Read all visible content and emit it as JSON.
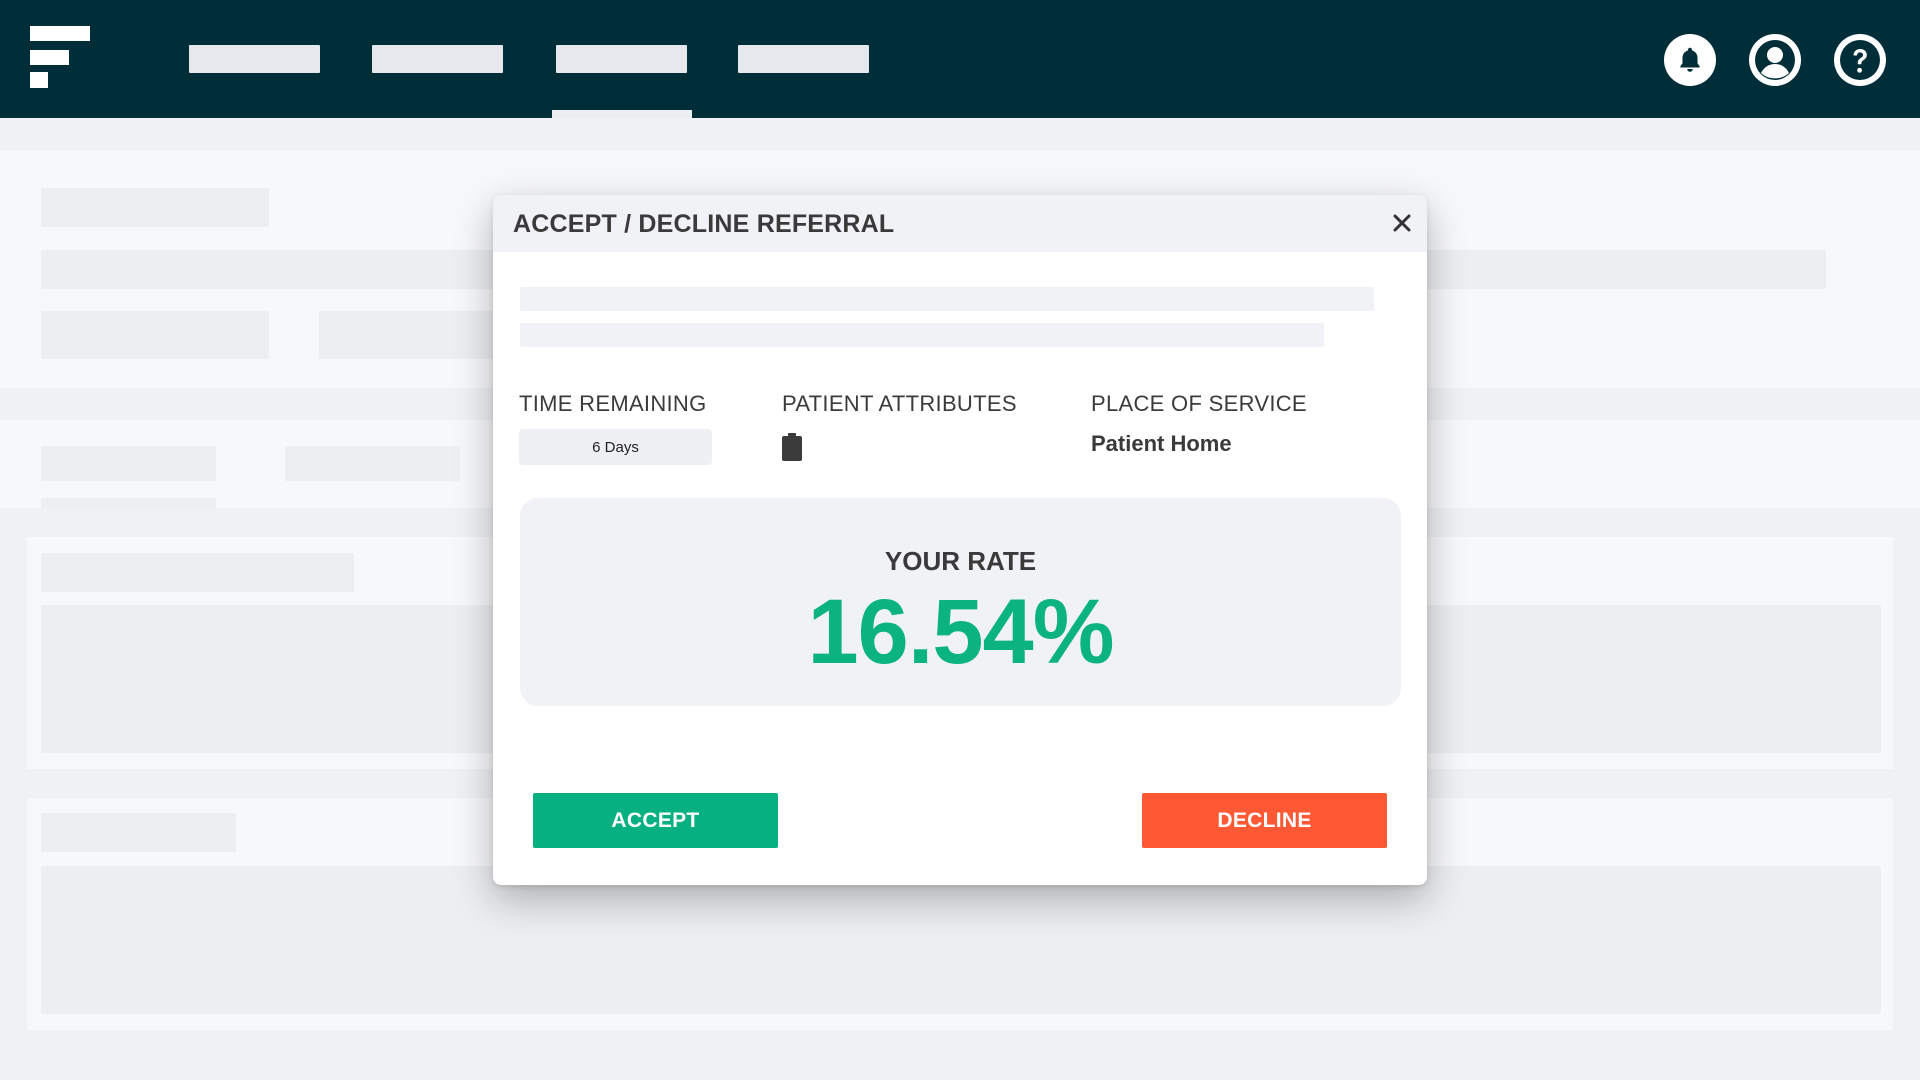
{
  "modal": {
    "title": "ACCEPT / DECLINE REFERRAL",
    "time_remaining_label": "TIME REMAINING",
    "time_remaining_value": "6 Days",
    "patient_attributes_label": "PATIENT ATTRIBUTES",
    "patient_attribute_icon": "clipboard-icon",
    "place_of_service_label": "PLACE OF SERVICE",
    "place_of_service_value": "Patient Home",
    "rate_label": "YOUR RATE",
    "rate_value": "16.54%",
    "accept_label": "ACCEPT",
    "decline_label": "DECLINE"
  },
  "header_icons": [
    "bell-icon",
    "user-icon",
    "help-icon"
  ],
  "colors": {
    "topbar": "#002e38",
    "accent_green": "#0bb381",
    "accept_button": "#06b081",
    "decline_button": "#fe5834"
  }
}
